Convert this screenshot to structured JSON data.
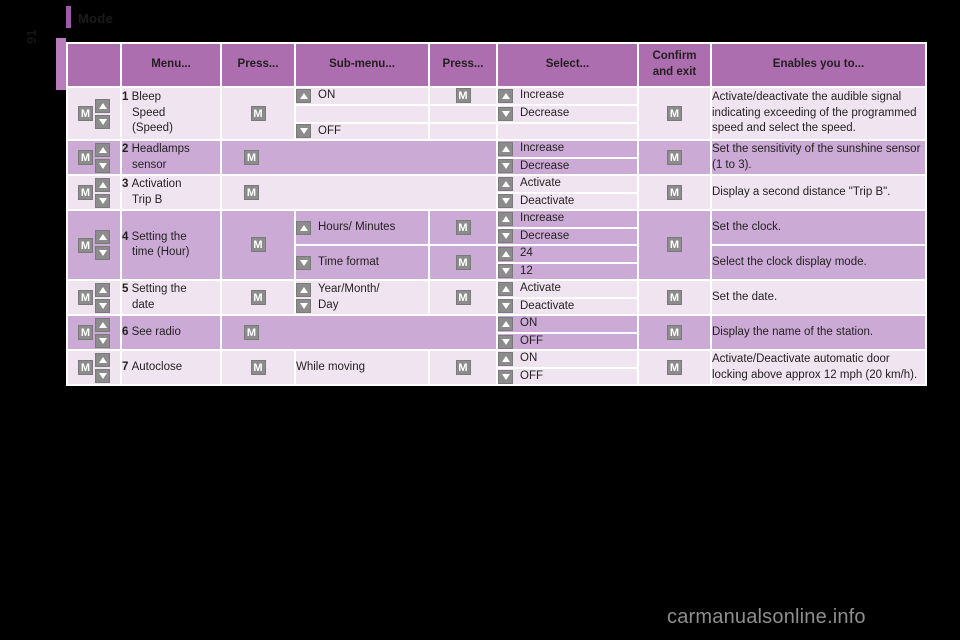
{
  "page": {
    "title": "Mode",
    "side_number": "91",
    "watermark": "carmanualsonline.info"
  },
  "icons": {
    "m_button": "M",
    "up": "up-arrow",
    "down": "down-arrow"
  },
  "table": {
    "headers": [
      "",
      "Menu...",
      "Press...",
      "Sub-menu...",
      "Press...",
      "Select...",
      "Confirm and exit",
      "Enables you to..."
    ],
    "header_confirm_line1": "Confirm",
    "header_confirm_line2": "and exit",
    "rows": [
      {
        "num": "1",
        "menu_line1": "Bleep",
        "menu_line2": "Speed",
        "menu_line3": "(Speed)",
        "press1": "M",
        "submenus": [
          {
            "arrow": "up",
            "label": "ON",
            "press": "M"
          },
          {
            "arrow": "",
            "label": "",
            "press": ""
          },
          {
            "arrow": "down",
            "label": "OFF",
            "press": ""
          }
        ],
        "selects": [
          {
            "arrow": "up",
            "label": "Increase"
          },
          {
            "arrow": "down",
            "label": "Decrease"
          }
        ],
        "confirm": "M",
        "description": "Activate/deactivate the audible signal indicating exceeding of the programmed speed and select the speed.",
        "shade": "light"
      },
      {
        "num": "2",
        "menu_line1": "Headlamps",
        "menu_line2": "sensor",
        "press1": "M",
        "submenus": [],
        "selects": [
          {
            "arrow": "up",
            "label": "Increase"
          },
          {
            "arrow": "down",
            "label": "Decrease"
          }
        ],
        "confirm": "M",
        "description": "Set the sensitivity of the sunshine sensor (1 to 3).",
        "shade": "dark"
      },
      {
        "num": "3",
        "menu_line1": "Activation",
        "menu_line2": "Trip B",
        "press1": "M",
        "submenus": [],
        "selects": [
          {
            "arrow": "up",
            "label": "Activate"
          },
          {
            "arrow": "down",
            "label": "Deactivate"
          }
        ],
        "confirm": "M",
        "description": "Display a second distance \"Trip B\".",
        "shade": "light"
      },
      {
        "num": "4",
        "menu_line1": "Setting the",
        "menu_line2": "time (Hour)",
        "press1": "M",
        "sub_blocks": [
          {
            "arrow": "up",
            "sub_label": "Hours/ Minutes",
            "press": "M",
            "selects": [
              {
                "arrow": "up",
                "label": "Increase"
              },
              {
                "arrow": "down",
                "label": "Decrease"
              }
            ],
            "description": "Set the clock."
          },
          {
            "arrow": "down",
            "sub_label": "Time format",
            "press": "M",
            "selects": [
              {
                "arrow": "up",
                "label": "24"
              },
              {
                "arrow": "down",
                "label": "12"
              }
            ],
            "description": "Select the clock display mode."
          }
        ],
        "confirm": "M",
        "shade": "dark"
      },
      {
        "num": "5",
        "menu_line1": "Setting the",
        "menu_line2": "date",
        "press1": "M",
        "sub_label_line1": "Year/Month/",
        "sub_label_line2": "Day",
        "press2": "M",
        "selects": [
          {
            "arrow": "up",
            "label": "Activate"
          },
          {
            "arrow": "down",
            "label": "Deactivate"
          }
        ],
        "confirm": "M",
        "description": "Set the date.",
        "shade": "light"
      },
      {
        "num": "6",
        "menu_line1": "See radio",
        "press1": "M",
        "selects": [
          {
            "arrow": "up",
            "label": "ON"
          },
          {
            "arrow": "down",
            "label": "OFF"
          }
        ],
        "confirm": "M",
        "description": "Display the name of the station.",
        "shade": "dark"
      },
      {
        "num": "7",
        "menu_line1": "Autoclose",
        "press1": "M",
        "sub_label": "While moving",
        "press2": "M",
        "selects": [
          {
            "arrow": "up",
            "label": "ON"
          },
          {
            "arrow": "down",
            "label": "OFF"
          }
        ],
        "confirm": "M",
        "description": "Activate/Deactivate automatic door locking above approx 12 mph (20 km/h).",
        "shade": "light"
      }
    ]
  },
  "colors": {
    "header_purple": "#ad6eb0",
    "row_light": "#f0e4f0",
    "row_dark": "#cbabd6",
    "button_gray": "#8c8c8c",
    "accent": "#a05ba8"
  }
}
